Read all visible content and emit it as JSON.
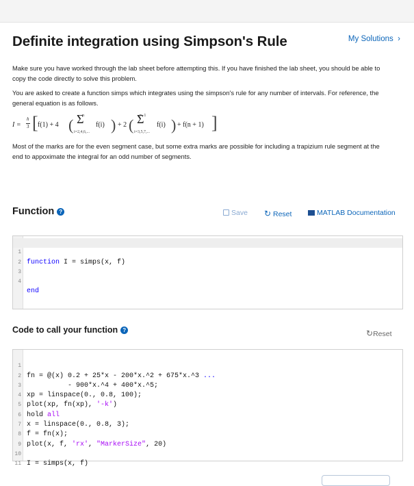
{
  "header": {
    "title": "Definite integration using Simpson's Rule",
    "my_solutions": "My Solutions"
  },
  "description": {
    "p1": "Make sure you have worked through the lab sheet before attempting this. If you have finished the lab sheet, you should be able to copy the code directly to solve this problem.",
    "p2": "You are asked to create a function simps which integrates using the simpson's rule for any number of intervals. For reference, the general equation is as follows.",
    "p3": "Most of the marks are for the even segment case, but some extra marks are possible for including a trapizium rule segment at the end to appoximate the integral for an odd number of segments."
  },
  "equation": {
    "lhs": "I =",
    "frac_num": "h",
    "frac_den": "3",
    "t1": "f(1) + 4",
    "sigma1_top": "n",
    "sigma1_bottom": "i=2,4,6,...",
    "sigma_body1": "f(i)",
    "plus2": "+ 2",
    "sigma2_top": "n−1",
    "sigma2_bottom": "i=3,5,7,...",
    "sigma_body2": "f(i)",
    "tail": "+ f(n + 1)"
  },
  "function_section": {
    "title": "Function",
    "save_label": "Save",
    "reset_label": "Reset",
    "doc_label": "MATLAB Documentation",
    "lines": [
      {
        "num": "1",
        "pre": "",
        "kw": "function",
        "post": " I = simps(x, f)"
      },
      {
        "num": "2",
        "pre": "",
        "kw": "",
        "post": ""
      },
      {
        "num": "3",
        "pre": "",
        "kw": "",
        "post": ""
      },
      {
        "num": "4",
        "pre": "",
        "kw": "end",
        "post": ""
      }
    ]
  },
  "call_section": {
    "title": "Code to call your function",
    "reset_label": "Reset",
    "lines": {
      "l1": "fn = @(x) 0.2 + 25*x - 200*x.^2 + 675*x.^3 ",
      "l1_cont": "...",
      "l2": "          - 900*x.^4 + 400*x.^5;",
      "l3": "xp = linspace(0., 0.8, 100);",
      "l4_a": "plot(xp, fn(xp), ",
      "l4_s": "'-k'",
      "l4_b": ")",
      "l5_a": "hold ",
      "l5_s": "all",
      "l6": "x = linspace(0., 0.8, 3);",
      "l7": "f = fn(x);",
      "l8_a": "plot(x, f, ",
      "l8_s1": "'rx'",
      "l8_m": ", ",
      "l8_s2": "\"MarkerSize\"",
      "l8_b": ", 20)",
      "l10": "I = simps(x, f)"
    },
    "numbers": [
      "1",
      "2",
      "3",
      "4",
      "5",
      "6",
      "7",
      "8",
      "9",
      "10",
      "11"
    ]
  },
  "colors": {
    "accent": "#0b65b9",
    "keyword": "#0e00ff",
    "string": "#a709f5"
  }
}
